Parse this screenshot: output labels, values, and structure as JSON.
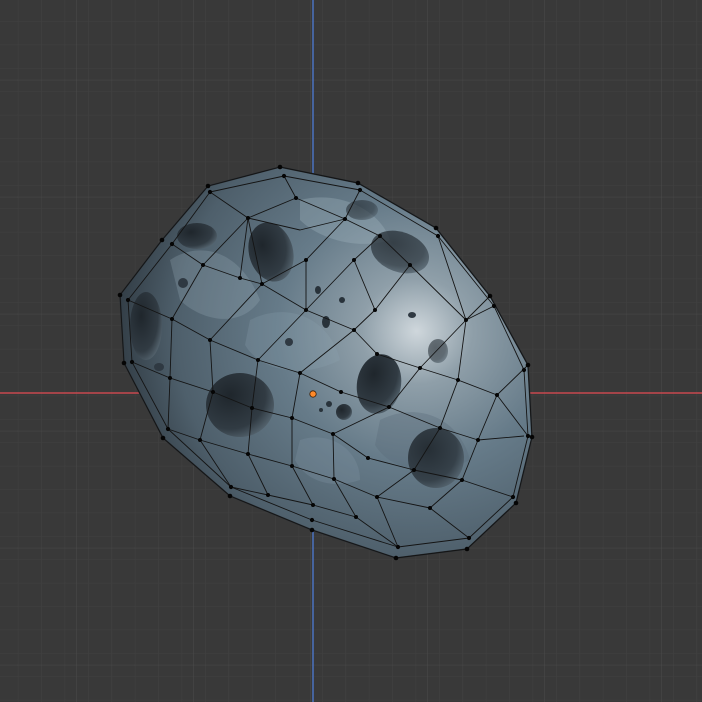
{
  "viewport": {
    "background": "#393939",
    "grid_minor_color": "#414141",
    "grid_major_color": "#4b4b4b",
    "x_axis_color": "#c8494f",
    "y_axis_color": "#4a6fb8"
  },
  "object": {
    "kind": "cratered-rock-mesh",
    "mode": "edit",
    "base_color": "#6f8594",
    "highlight_color": "#b7c3cb",
    "shadow_color": "#2b333a",
    "wire_color": "#141414",
    "vertex_color": "#050505",
    "origin_color": "#ff8a2a"
  }
}
